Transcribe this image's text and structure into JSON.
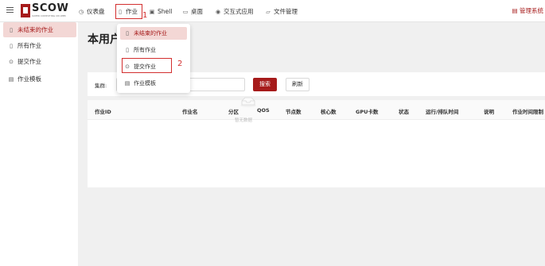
{
  "header": {
    "logo_text": "SCOW",
    "logo_sub": "SUPER COMPUTING ON WEB",
    "nav": [
      {
        "label": "仪表盘",
        "icon": "dashboard-icon"
      },
      {
        "label": "作业",
        "icon": "file-icon"
      },
      {
        "label": "Shell",
        "icon": "terminal-icon"
      },
      {
        "label": "桌面",
        "icon": "desktop-icon"
      },
      {
        "label": "交互式应用",
        "icon": "eye-icon"
      },
      {
        "label": "文件管理",
        "icon": "folder-icon"
      }
    ],
    "right_link": "管理系统"
  },
  "sidebar": {
    "items": [
      {
        "label": "未结束的作业",
        "icon": "file-icon"
      },
      {
        "label": "所有作业",
        "icon": "file-icon"
      },
      {
        "label": "提交作业",
        "icon": "plus-circle-icon"
      },
      {
        "label": "作业模板",
        "icon": "template-icon"
      }
    ]
  },
  "main": {
    "title": "本用户未结束的作业",
    "filter_label": "集群:",
    "filter_value": "",
    "search_label": "搜索",
    "refresh_label": "刷新",
    "columns": [
      "作业ID",
      "作业名",
      "分区",
      "QOS",
      "节点数",
      "核心数",
      "GPU卡数",
      "状态",
      "运行/排队时间",
      "说明",
      "作业时间限制"
    ],
    "empty_text": "暂无数据"
  },
  "dropdown": {
    "items": [
      {
        "label": "未结束的作业",
        "icon": "file-icon"
      },
      {
        "label": "所有作业",
        "icon": "file-icon"
      },
      {
        "label": "提交作业",
        "icon": "plus-circle-icon"
      },
      {
        "label": "作业模板",
        "icon": "template-icon"
      }
    ]
  },
  "annotations": {
    "step1": "1",
    "step2": "2"
  },
  "colors": {
    "accent": "#a61b1b",
    "highlight_box": "#d32f2f",
    "active_bg": "#f3d7d5"
  }
}
